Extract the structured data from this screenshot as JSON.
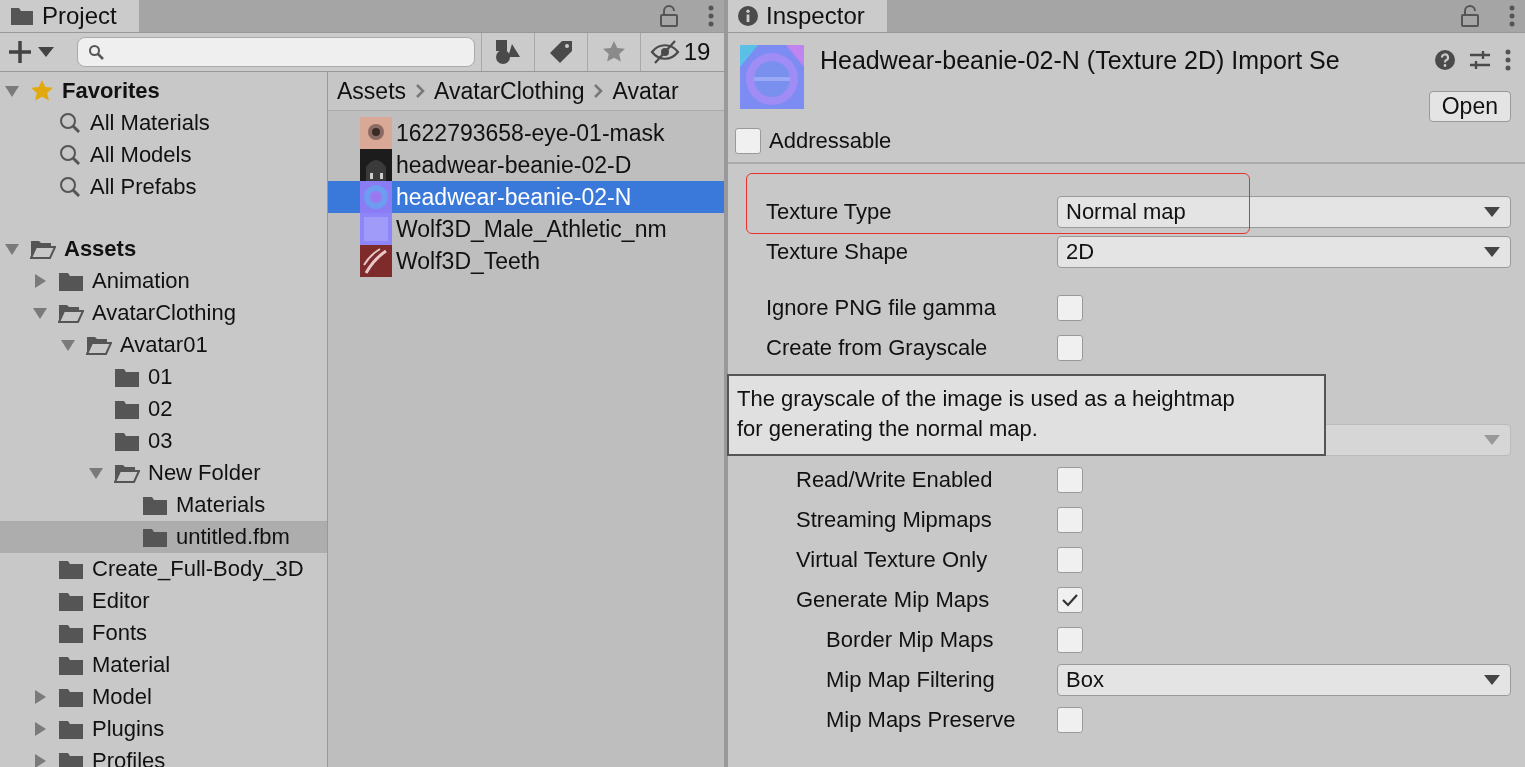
{
  "project": {
    "tab": "Project",
    "hidden_count": "19",
    "tree": [
      {
        "kind": "favorites",
        "label": "Favorites",
        "expanded": true,
        "selected": false,
        "children": [
          {
            "kind": "search",
            "label": "All Materials",
            "selected": false
          },
          {
            "kind": "search",
            "label": "All Models",
            "selected": false
          },
          {
            "kind": "search",
            "label": "All Prefabs",
            "selected": false
          }
        ]
      },
      {
        "kind": "folder",
        "label": "Assets",
        "expanded": true,
        "selected": false,
        "children": [
          {
            "kind": "folder",
            "label": "Animation",
            "expanded": false,
            "selected": false
          },
          {
            "kind": "folder",
            "label": "AvatarClothing",
            "expanded": true,
            "selected": false,
            "children": [
              {
                "kind": "folder",
                "label": "Avatar01",
                "expanded": true,
                "selected": false,
                "children": [
                  {
                    "kind": "folder",
                    "label": "01",
                    "selected": false
                  },
                  {
                    "kind": "folder",
                    "label": "02",
                    "selected": false
                  },
                  {
                    "kind": "folder",
                    "label": "03",
                    "selected": false
                  },
                  {
                    "kind": "folder",
                    "label": "New Folder",
                    "expanded": true,
                    "selected": false,
                    "children": [
                      {
                        "kind": "folder",
                        "label": "Materials",
                        "selected": false
                      },
                      {
                        "kind": "folder",
                        "label": "untitled.fbm",
                        "selected": true
                      }
                    ]
                  }
                ]
              }
            ]
          },
          {
            "kind": "folder",
            "label": "Create_Full-Body_3D",
            "selected": false
          },
          {
            "kind": "folder",
            "label": "Editor",
            "selected": false
          },
          {
            "kind": "folder",
            "label": "Fonts",
            "selected": false
          },
          {
            "kind": "folder",
            "label": "Material",
            "selected": false
          },
          {
            "kind": "folder",
            "label": "Model",
            "expanded": false,
            "selected": false
          },
          {
            "kind": "folder",
            "label": "Plugins",
            "expanded": false,
            "selected": false
          },
          {
            "kind": "folder",
            "label": "Profiles",
            "expanded": false,
            "selected": false
          }
        ]
      }
    ],
    "breadcrumb": [
      "Assets",
      "AvatarClothing",
      "Avatar"
    ],
    "files": [
      {
        "label": "1622793658-eye-01-mask",
        "selected": false
      },
      {
        "label": "headwear-beanie-02-D",
        "selected": false
      },
      {
        "label": "headwear-beanie-02-N",
        "selected": true
      },
      {
        "label": "Wolf3D_Male_Athletic_nm",
        "selected": false
      },
      {
        "label": "Wolf3D_Teeth",
        "selected": false
      }
    ]
  },
  "inspector": {
    "tab": "Inspector",
    "title": "Headwear-beanie-02-N (Texture 2D) Import Se",
    "open_button": "Open",
    "addressable": {
      "label": "Addressable",
      "checked": false
    },
    "sections": [
      [
        {
          "kind": "dropdown",
          "label": "Texture Type",
          "value": "Normal map",
          "highlighted": true
        },
        {
          "kind": "dropdown",
          "label": "Texture Shape",
          "value": "2D"
        }
      ],
      [
        {
          "kind": "checkbox",
          "label": "Ignore PNG file gamma",
          "checked": false
        },
        {
          "kind": "checkbox",
          "label": "Create from Grayscale",
          "checked": false
        },
        {
          "kind": "foldout",
          "children": [
            {
              "kind": "dropdown",
              "disabled": true
            },
            {
              "kind": "checkbox",
              "label": "Read/Write Enabled",
              "checked": false
            },
            {
              "kind": "checkbox",
              "label": "Streaming Mipmaps",
              "checked": false
            },
            {
              "kind": "checkbox",
              "label": "Virtual Texture Only",
              "checked": false
            },
            {
              "kind": "checkbox",
              "label": "Generate Mip Maps",
              "checked": true,
              "children": [
                {
                  "kind": "checkbox",
                  "label": "Border Mip Maps",
                  "checked": false
                },
                {
                  "kind": "dropdown",
                  "label": "Mip Map Filtering",
                  "value": "Box"
                },
                {
                  "kind": "checkbox",
                  "label": "Mip Maps Preserve",
                  "checked": false
                }
              ]
            }
          ]
        }
      ]
    ],
    "tooltip": "The grayscale of the image is used as a heightmap\nfor generating the normal map."
  }
}
